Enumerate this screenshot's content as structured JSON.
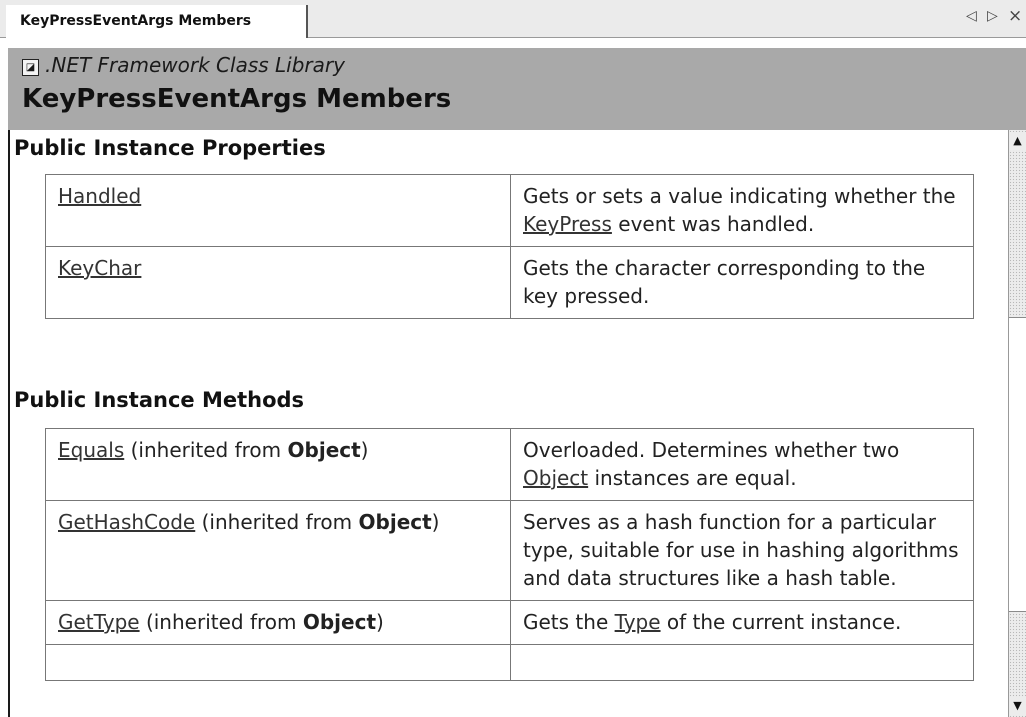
{
  "tab": {
    "label": "KeyPressEventArgs Members"
  },
  "tab_controls": {
    "prev": "◁",
    "next": "▷",
    "close": "×"
  },
  "banner": {
    "library": ".NET Framework Class Library",
    "title": "KeyPressEventArgs Members"
  },
  "sections": {
    "properties": {
      "heading": "Public Instance Properties",
      "rows": [
        {
          "name": "Handled",
          "desc_a": "Gets or sets a value indicating whether the ",
          "desc_link": "KeyPress",
          "desc_b": " event was handled."
        },
        {
          "name": "KeyChar",
          "desc_a": "Gets the character corresponding to the key pressed."
        }
      ]
    },
    "methods": {
      "heading": "Public Instance Methods",
      "rows": [
        {
          "name": "Equals",
          "inherited": " (inherited from ",
          "owner": "Object",
          "close": ")",
          "desc_a": "Overloaded. Determines whether two ",
          "desc_link": "Object",
          "desc_b": " instances are equal."
        },
        {
          "name": "GetHashCode",
          "inherited": " (inherited from ",
          "owner": "Object",
          "close": ")",
          "desc_a": "Serves as a hash function for a particular type, suitable for use in hashing algorithms and data structures like a hash table."
        },
        {
          "name": "GetType",
          "inherited": " (inherited from ",
          "owner": "Object",
          "close": ")",
          "desc_a": "Gets the ",
          "desc_link": "Type",
          "desc_b": " of the current instance."
        }
      ]
    }
  },
  "scrollbar": {
    "up": "▲",
    "down": "▼"
  }
}
